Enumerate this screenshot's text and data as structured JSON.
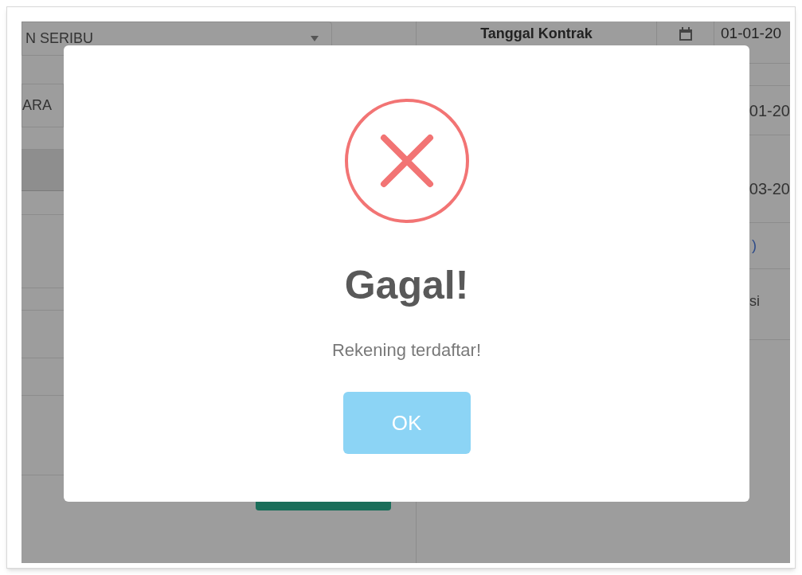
{
  "background": {
    "select_value": "N SERIBU",
    "field_value": "ARA",
    "contract_label": "Tanggal Kontrak",
    "dates": [
      "01-01-20",
      "01-20",
      "03-20"
    ],
    "fragments": [
      ")",
      "si"
    ]
  },
  "dialog": {
    "kind": "error",
    "title": "Gagal!",
    "message": "Rekening terdaftar!",
    "button": "OK"
  }
}
